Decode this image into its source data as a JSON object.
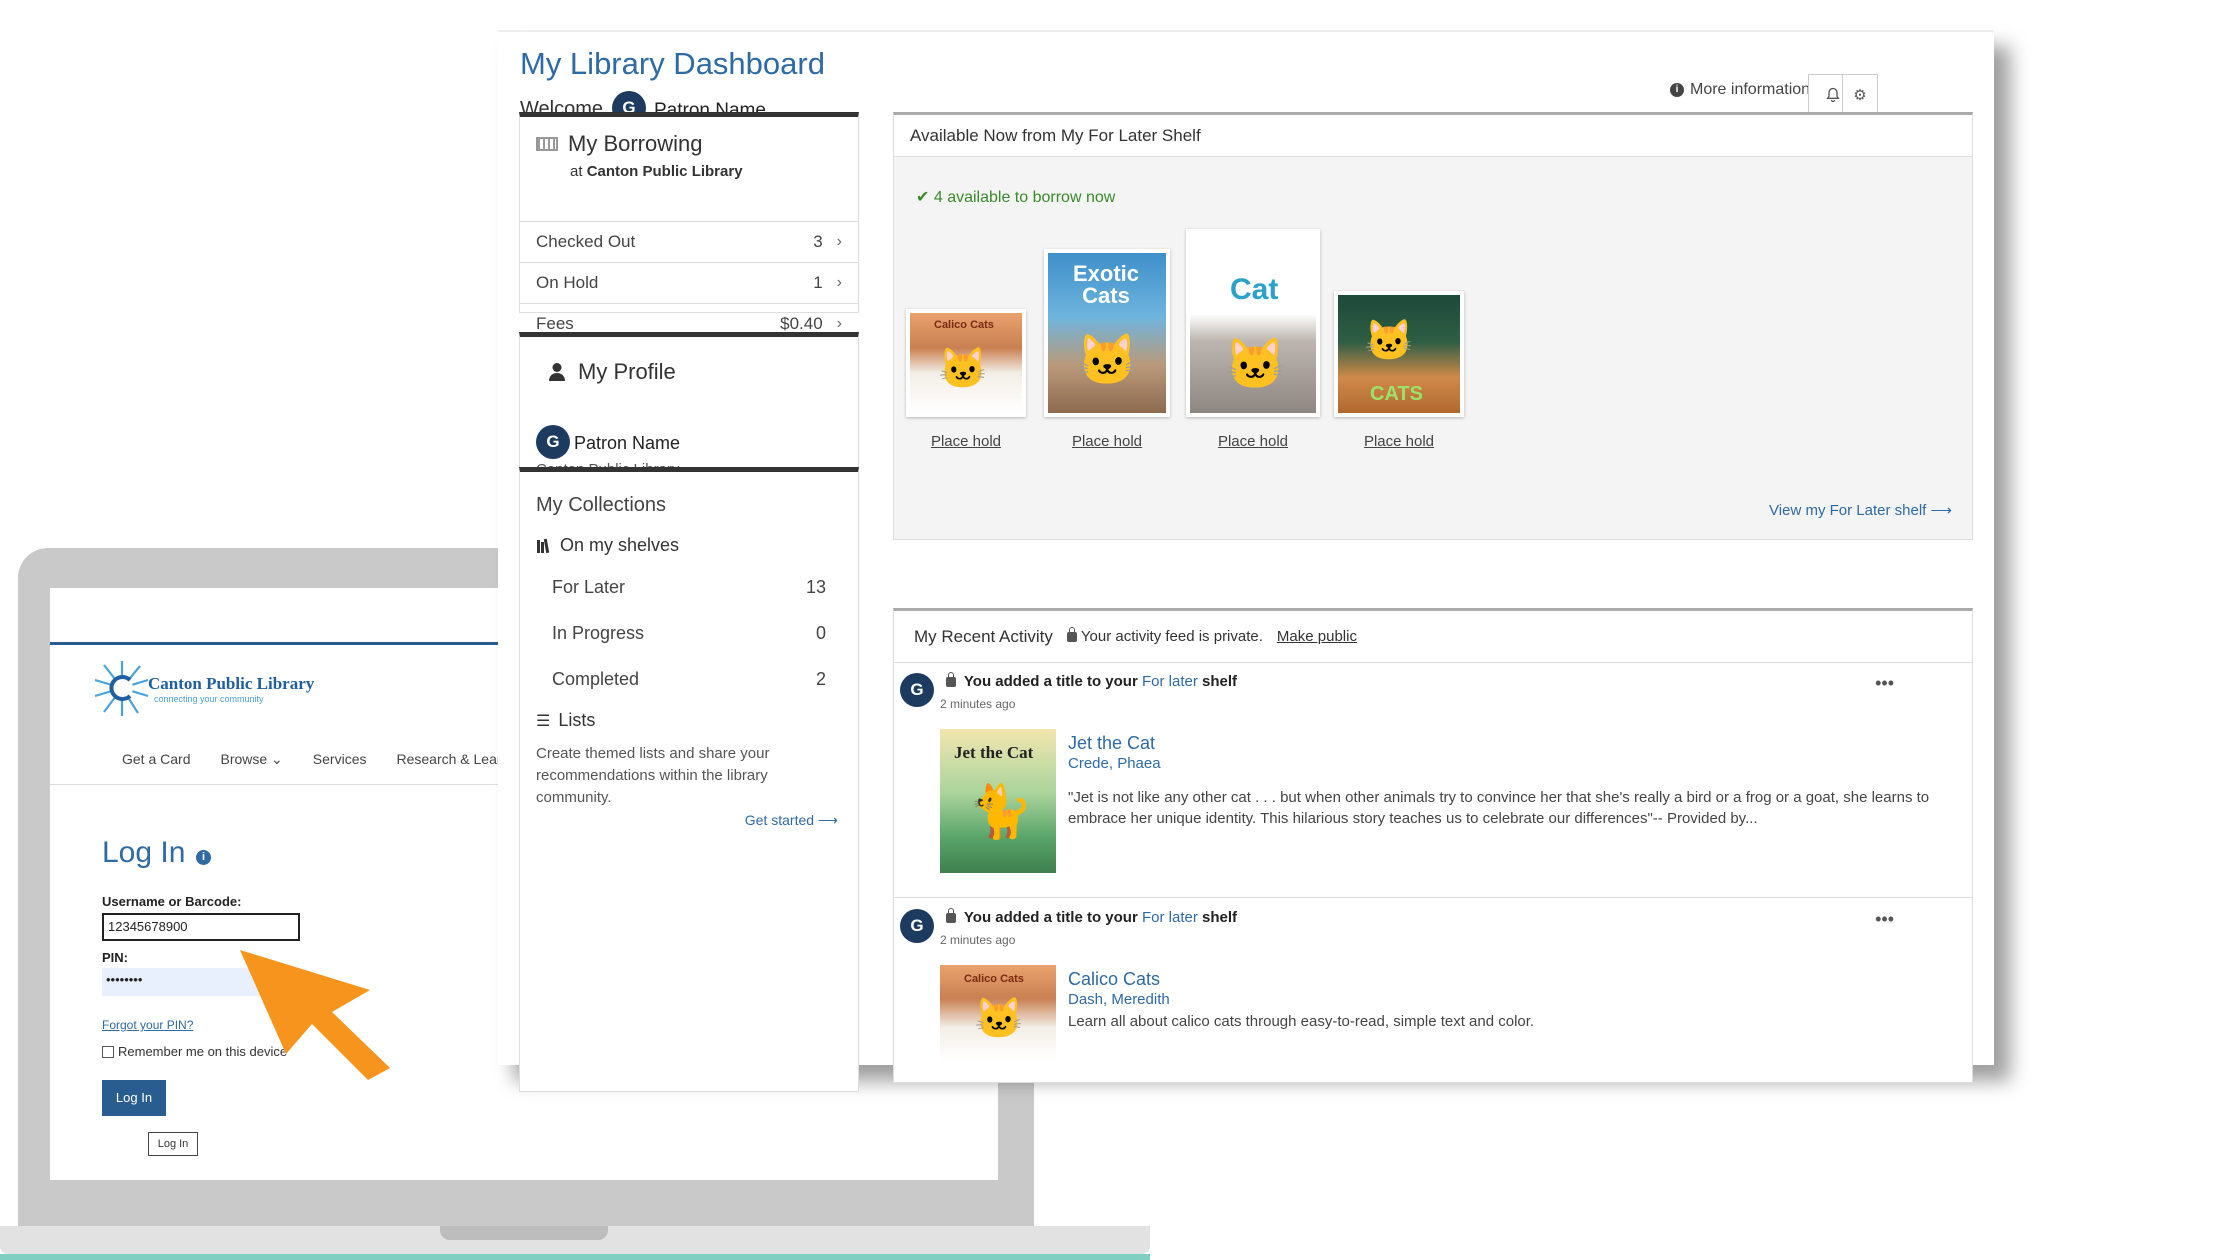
{
  "login": {
    "library_name": "Canton Public Library",
    "library_tagline": "connecting your community",
    "nav": [
      "Get a Card",
      "Browse ⌄",
      "Services",
      "Research & Learn"
    ],
    "title": "Log In",
    "username_label": "Username or Barcode:",
    "username_value": "12345678900",
    "pin_label": "PIN:",
    "pin_value": "••••••••",
    "forgot_link": "Forgot your PIN?",
    "remember_label": "Remember me on this device",
    "login_button": "Log In",
    "login_button_small": "Log In"
  },
  "dashboard": {
    "title": "My Library Dashboard",
    "welcome": "Welcome,",
    "avatar_letter": "G",
    "patron_name": "Patron Name",
    "more_info": "More information",
    "bell_icon": "bell-icon",
    "gear_icon": "gear-icon"
  },
  "borrowing": {
    "title": "My Borrowing",
    "at_label": "at",
    "library": "Canton Public Library",
    "rows": [
      {
        "label": "Checked Out",
        "value": "3"
      },
      {
        "label": "On Hold",
        "value": "1"
      },
      {
        "label": "Fees",
        "value": "$0.40"
      }
    ]
  },
  "profile": {
    "title": "My Profile",
    "avatar_letter": "G",
    "name": "Patron Name",
    "library": "Canton Public Library"
  },
  "collections": {
    "title": "My Collections",
    "shelves_label": "On my shelves",
    "shelves": [
      {
        "label": "For Later",
        "value": "13"
      },
      {
        "label": "In Progress",
        "value": "0"
      },
      {
        "label": "Completed",
        "value": "2"
      }
    ],
    "lists_label": "Lists",
    "lists_desc": "Create themed lists and share your recommendations within the library community.",
    "get_started": "Get started ⟶"
  },
  "available": {
    "title": "Available Now from My For Later Shelf",
    "count_text": "4 available to borrow now",
    "books": [
      {
        "cover_text": "Calico Cats",
        "action": "Place hold"
      },
      {
        "cover_text": "Exotic Cats",
        "action": "Place hold"
      },
      {
        "cover_text": "Cat",
        "action": "Place hold"
      },
      {
        "cover_text": "CATS",
        "action": "Place hold"
      }
    ],
    "view_shelf": "View my For Later shelf ⟶"
  },
  "activity": {
    "title": "My Recent Activity",
    "private_text": "Your activity feed is private.",
    "make_public": "Make public",
    "items": [
      {
        "avatar": "G",
        "text_prefix": "You added a title to your",
        "shelf": "For later",
        "text_suffix": "shelf",
        "time": "2 minutes ago",
        "cover_text": "Jet the Cat",
        "title": "Jet the Cat",
        "author": "Crede, Phaea",
        "description": "\"Jet is not like any other cat . . . but when other animals try to convince her that she's really a bird or a frog or a goat, she learns to embrace her unique identity. This hilarious story teaches us to celebrate our differences\"-- Provided by..."
      },
      {
        "avatar": "G",
        "text_prefix": "You added a title to your",
        "shelf": "For later",
        "text_suffix": "shelf",
        "time": "2 minutes ago",
        "cover_text": "Calico Cats",
        "title": "Calico Cats",
        "author": "Dash, Meredith",
        "description": "Learn all about calico cats through easy-to-read, simple text and color."
      }
    ]
  },
  "colors": {
    "brand_blue": "#2e6aa3",
    "dark_navy": "#1d3a5f",
    "success_green": "#3a8a2a",
    "arrow_orange": "#f7941d"
  }
}
